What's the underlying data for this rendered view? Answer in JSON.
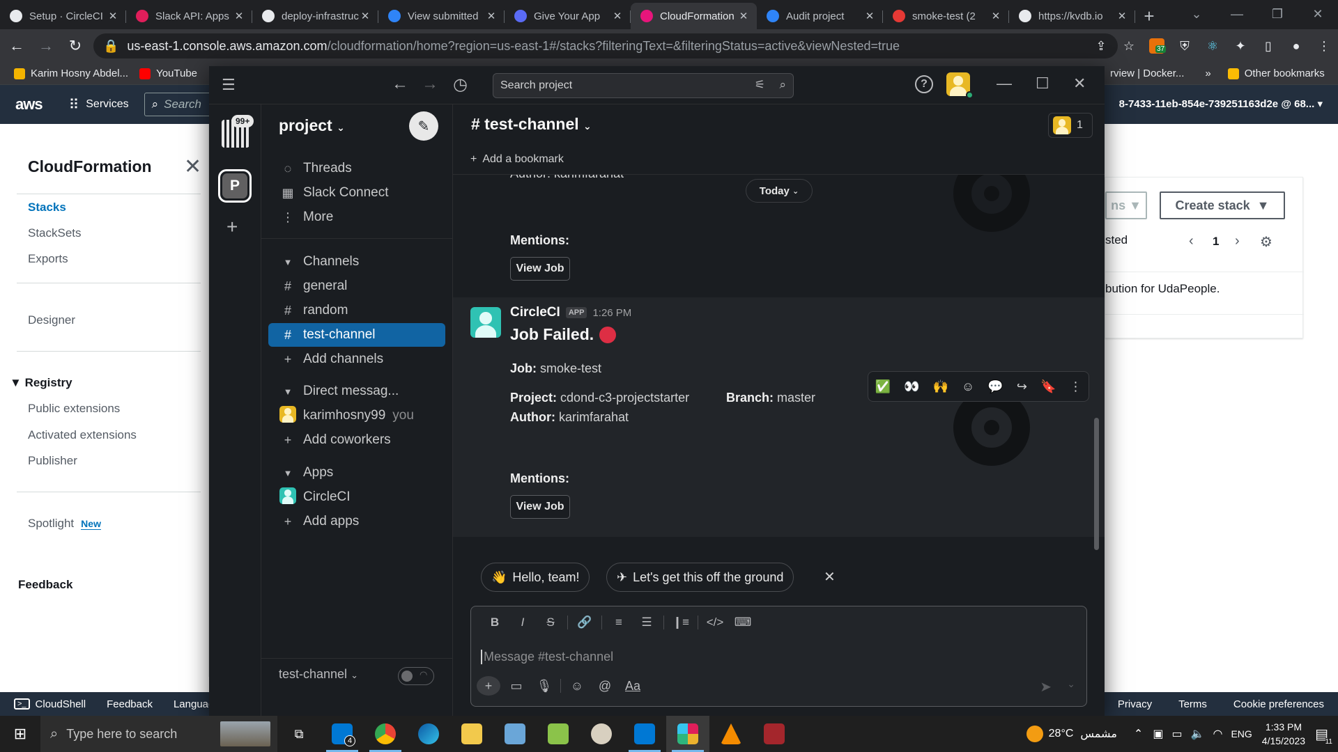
{
  "browser": {
    "tabs": [
      {
        "title": "Setup · CircleCI",
        "color": "#e8eaed"
      },
      {
        "title": "Slack API: Apps",
        "color": "#e01e5a"
      },
      {
        "title": "deploy-infrastructure",
        "color": "#e8eaed"
      },
      {
        "title": "View submitted",
        "color": "#2f84f7"
      },
      {
        "title": "Give Your App",
        "color": "#5a6bf5"
      },
      {
        "title": "CloudFormation",
        "color": "#e7157b"
      },
      {
        "title": "Audit project",
        "color": "#2f84f7"
      },
      {
        "title": "smoke-test (2",
        "color": "#e53935"
      },
      {
        "title": "https://kvdb.io",
        "color": "#e8eaed"
      }
    ],
    "active_tab_index": 5,
    "url_host": "us-east-1.console.aws.amazon.com",
    "url_path": "/cloudformation/home?region=us-east-1#/stacks?filteringText=&filteringStatus=active&viewNested=true",
    "extension_badge": "37",
    "bookmarks": [
      {
        "label": "Karim Hosny Abdel...",
        "color": "#f4b400"
      },
      {
        "label": "YouTube",
        "color": "#ff0000"
      }
    ],
    "bookmarks_right": {
      "partial": "rview | Docker...",
      "more": "»",
      "other": "Other bookmarks"
    }
  },
  "aws": {
    "logo": "aws",
    "services": "Services",
    "search_placeholder": "Search",
    "account": "8-7433-11eb-854e-739251163d2e @ 68...",
    "sidebar": {
      "title": "CloudFormation",
      "items": [
        "Stacks",
        "StackSets",
        "Exports"
      ],
      "designer": "Designer",
      "registry": "Registry",
      "registry_items": [
        "Public extensions",
        "Activated extensions",
        "Publisher"
      ],
      "spotlight": "Spotlight",
      "spotlight_badge": "New",
      "feedback": "Feedback"
    },
    "main": {
      "actions_partial": "ns",
      "create_stack": "Create stack",
      "filter_partial": "sted",
      "page": "1",
      "description_partial": "bution for UdaPeople."
    },
    "footer": {
      "cloudshell": "CloudShell",
      "feedback": "Feedback",
      "language": "Language",
      "privacy": "Privacy",
      "terms": "Terms",
      "cookies": "Cookie preferences"
    }
  },
  "slack": {
    "search_placeholder": "Search project",
    "workspace_badge": "99+",
    "workspace_initial": "P",
    "workspace_name": "project",
    "nav": [
      "Threads",
      "Slack Connect",
      "More"
    ],
    "channels_header": "Channels",
    "channels": [
      "general",
      "random",
      "test-channel"
    ],
    "add_channels": "Add channels",
    "dm_header": "Direct messag...",
    "dm_user": "karimhosny99",
    "dm_you": "you",
    "add_coworkers": "Add coworkers",
    "apps_header": "Apps",
    "app_name": "CircleCI",
    "add_apps": "Add apps",
    "sidebar_footer": "test-channel",
    "channel_title": "# test-channel",
    "member_count": "1",
    "add_bookmark": "Add a bookmark",
    "today_pill": "Today",
    "prev_message": {
      "author_partial": "Author: karimfarahat",
      "mentions": "Mentions:",
      "button": "View Job"
    },
    "message": {
      "sender": "CircleCI",
      "app_badge": "APP",
      "time": "1:26 PM",
      "headline": "Job Failed.",
      "job_label": "Job:",
      "job": "smoke-test",
      "project_label": "Project:",
      "project": "cdond-c3-projectstarter",
      "branch_label": "Branch:",
      "branch": "master",
      "author_label": "Author:",
      "author": "karimfarahat",
      "mentions": "Mentions:",
      "button": "View Job"
    },
    "suggestions": [
      "Hello, team!",
      "Let's get this off the ground"
    ],
    "composer_placeholder": "Message #test-channel"
  },
  "taskbar": {
    "search_placeholder": "Type here to search",
    "mail_badge": "4",
    "weather": "28°C",
    "weather_text": "مشمس",
    "language": "ENG",
    "time": "1:33 PM",
    "date": "4/15/2023",
    "notifications": "11"
  }
}
